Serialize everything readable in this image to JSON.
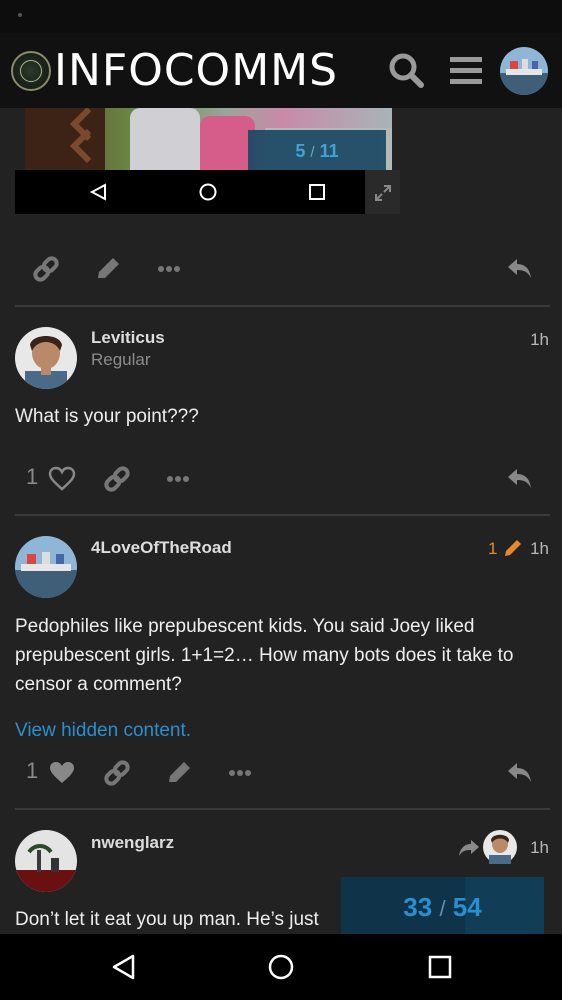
{
  "header": {
    "title": "INFOCOMMS",
    "icons": [
      "seal-logo",
      "search-icon",
      "hamburger-menu-icon",
      "user-avatar"
    ]
  },
  "gallery": {
    "current": "5",
    "separator": "/",
    "total": "11",
    "nav_icons": [
      "back-triangle-icon",
      "home-circle-icon",
      "recents-square-icon",
      "expand-icon"
    ]
  },
  "posts": [
    {
      "actions": [
        "link-icon",
        "edit-pencil-icon",
        "more-icon",
        "reply-icon"
      ]
    },
    {
      "username": "Leviticus",
      "user_title": "Regular",
      "time": "1h",
      "body": "What is your point???",
      "like_count": "1",
      "actions": [
        "heart-icon",
        "link-icon",
        "more-icon",
        "reply-icon"
      ]
    },
    {
      "username": "4LoveOfTheRoad",
      "edit_count": "1",
      "time": "1h",
      "body": "Pedophiles like prepubescent kids. You said Joey liked prepubescent girls. 1+1=2… How many bots does it take to censor a comment?",
      "hidden_link": "View hidden content.",
      "like_count": "1",
      "actions": [
        "heart-icon",
        "link-icon",
        "edit-pencil-icon",
        "more-icon",
        "reply-icon"
      ]
    },
    {
      "username": "nwenglarz",
      "time": "1h",
      "body": "Don’t let it eat you up man. He’s just",
      "actions": [
        "reply-to-arrow-icon",
        "reply-to-avatar"
      ]
    }
  ],
  "timeline": {
    "current": "33",
    "separator": "/",
    "total": "54",
    "progress": 0.61
  },
  "system_nav": {
    "icons": [
      "back-icon",
      "home-icon",
      "recents-icon"
    ]
  },
  "colors": {
    "background": "#222222",
    "header": "#111111",
    "accent_blue": "#2a8fd0",
    "edit_orange": "#e58a2a"
  }
}
